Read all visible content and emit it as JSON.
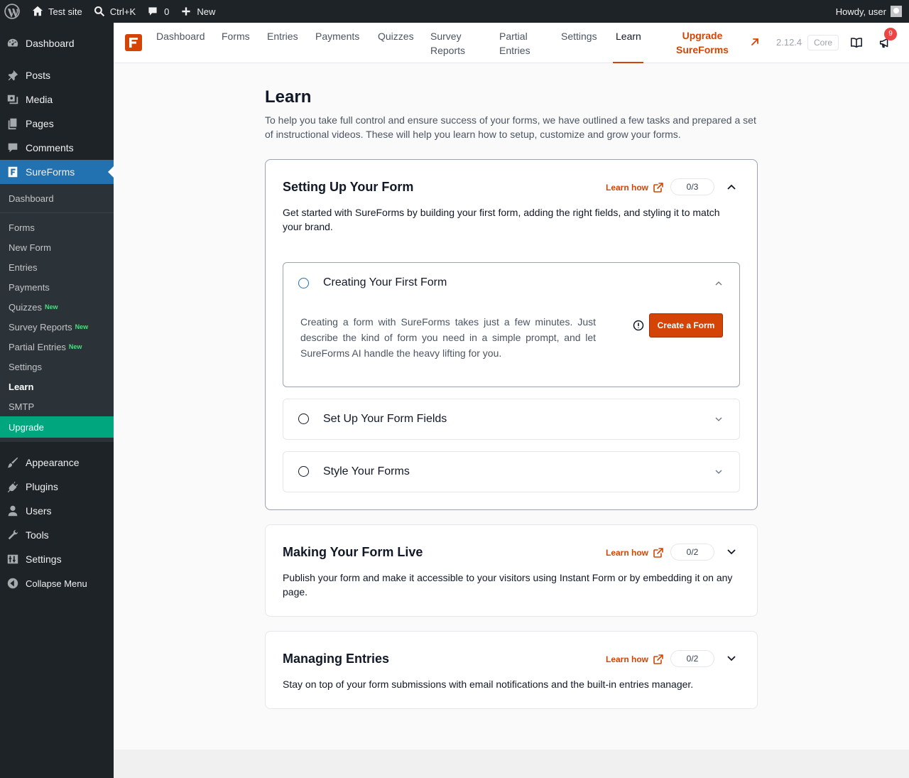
{
  "adminbar": {
    "site_name": "Test site",
    "search_shortcut": "Ctrl+K",
    "comments_count": "0",
    "new_label": "New",
    "howdy": "Howdy, user"
  },
  "sidebar": {
    "items_top": [
      "Dashboard",
      "Posts",
      "Media",
      "Pages",
      "Comments"
    ],
    "active": "SureForms",
    "submenu": {
      "dashboard": "Dashboard",
      "forms": "Forms",
      "new_form": "New Form",
      "entries": "Entries",
      "payments": "Payments",
      "quizzes": "Quizzes",
      "survey_reports": "Survey Reports",
      "partial_entries": "Partial Entries",
      "settings": "Settings",
      "learn": "Learn",
      "smtp": "SMTP",
      "upgrade": "Upgrade",
      "new_badge": "New"
    },
    "items_bottom": [
      "Appearance",
      "Plugins",
      "Users",
      "Tools",
      "Settings",
      "Collapse Menu"
    ]
  },
  "topnav": {
    "items": [
      "Dashboard",
      "Forms",
      "Entries",
      "Payments",
      "Quizzes",
      "Survey Reports",
      "Partial Entries",
      "Settings",
      "Learn"
    ],
    "upgrade_label": "Upgrade SureForms",
    "version": "2.12.4",
    "core_label": "Core",
    "notification_count": "9"
  },
  "page": {
    "title": "Learn",
    "description": "To help you take full control and ensure success of your forms, we have outlined a few tasks and prepared a set of instructional videos. These will help you learn how to setup, customize and grow your forms."
  },
  "sections": [
    {
      "title": "Setting Up Your Form",
      "learn_how": "Learn how",
      "progress": "0/3",
      "description": "Get started with SureForms by building your first form, adding the right fields, and styling it to match your brand.",
      "steps": [
        {
          "title": "Creating Your First Form",
          "body": "Creating a form with SureForms takes just a few minutes. Just describe the kind of form you need in a simple prompt, and let SureForms AI handle the heavy lifting for you.",
          "button": "Create a Form"
        },
        {
          "title": "Set Up Your Form Fields"
        },
        {
          "title": "Style Your Forms"
        }
      ]
    },
    {
      "title": "Making Your Form Live",
      "learn_how": "Learn how",
      "progress": "0/2",
      "description": "Publish your form and make it accessible to your visitors using Instant Form or by embedding it on any page."
    },
    {
      "title": "Managing Entries",
      "learn_how": "Learn how",
      "progress": "0/2",
      "description": "Stay on top of your form submissions with email notifications and the built-in entries manager."
    }
  ],
  "colors": {
    "brand": "#d54407",
    "wp_active": "#2271b1",
    "upgrade_green": "#00a67e"
  }
}
